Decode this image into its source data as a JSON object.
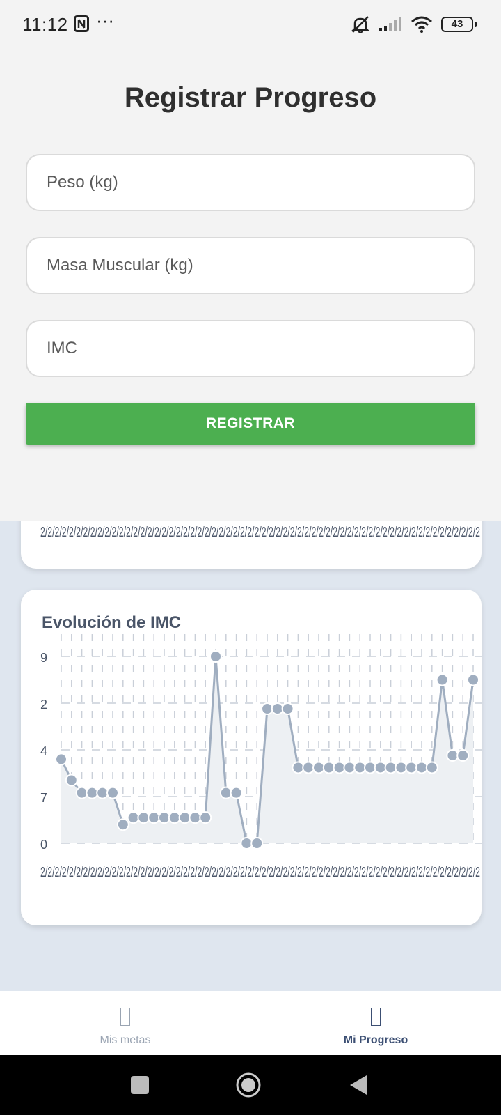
{
  "status": {
    "time": "11:12",
    "dots": "···",
    "battery": "43"
  },
  "form": {
    "title": "Registrar Progreso",
    "peso_placeholder": "Peso (kg)",
    "masa_placeholder": "Masa Muscular (kg)",
    "imc_placeholder": "IMC",
    "submit_label": "REGISTRAR"
  },
  "prev_chart": {
    "x_tick_text": "2/2/2/2/2/2/2/2/2/2/2/2/2/2/2/2/2/2/2/2/2/2/2/2/2/2/2/2/2/2/2/2/2/2/2/2/2/2/2/2/2/2/2/2/2/2/2/2/2/2/2/2/2/2/2/2/2/2/2/2/2/2"
  },
  "chart_data": {
    "type": "line",
    "title": "Evolución de IMC",
    "y_tick_labels": [
      "9",
      "2",
      "4",
      "7",
      "0"
    ],
    "x_tick_text": "2/2/2/2/2/2/2/2/2/2/2/2/2/2/2/2/2/2/2/2/2/2/2/2/2/2/2/2/2/2/2/2/2/2/2/2/2/2/2/2/2/2/2/2/2/2/2/2/2/2/2/2/2/2/2/2/2/2/2/2/2/2",
    "ylim": [
      0,
      4
    ],
    "grid": true,
    "area_fill": true,
    "series_color": "#a0aec0",
    "fill_color": "#edf0f3",
    "values": [
      1.8,
      1.35,
      1.08,
      1.08,
      1.08,
      1.08,
      0.4,
      0.55,
      0.55,
      0.55,
      0.55,
      0.55,
      0.55,
      0.55,
      0.55,
      4.0,
      1.08,
      1.08,
      0.0,
      0.0,
      2.88,
      2.88,
      2.88,
      1.62,
      1.62,
      1.62,
      1.62,
      1.62,
      1.62,
      1.62,
      1.62,
      1.62,
      1.62,
      1.62,
      1.62,
      1.62,
      1.62,
      3.5,
      1.88,
      1.88,
      3.5
    ]
  },
  "nav": {
    "items": [
      {
        "label": "Mis metas",
        "active": false
      },
      {
        "label": "Mi Progreso",
        "active": true
      }
    ]
  },
  "colors": {
    "accent_green": "#4caf50",
    "nav_active": "#3c4f73",
    "nav_inactive": "#9aa4b2",
    "page_bg": "#dfe6ef"
  }
}
